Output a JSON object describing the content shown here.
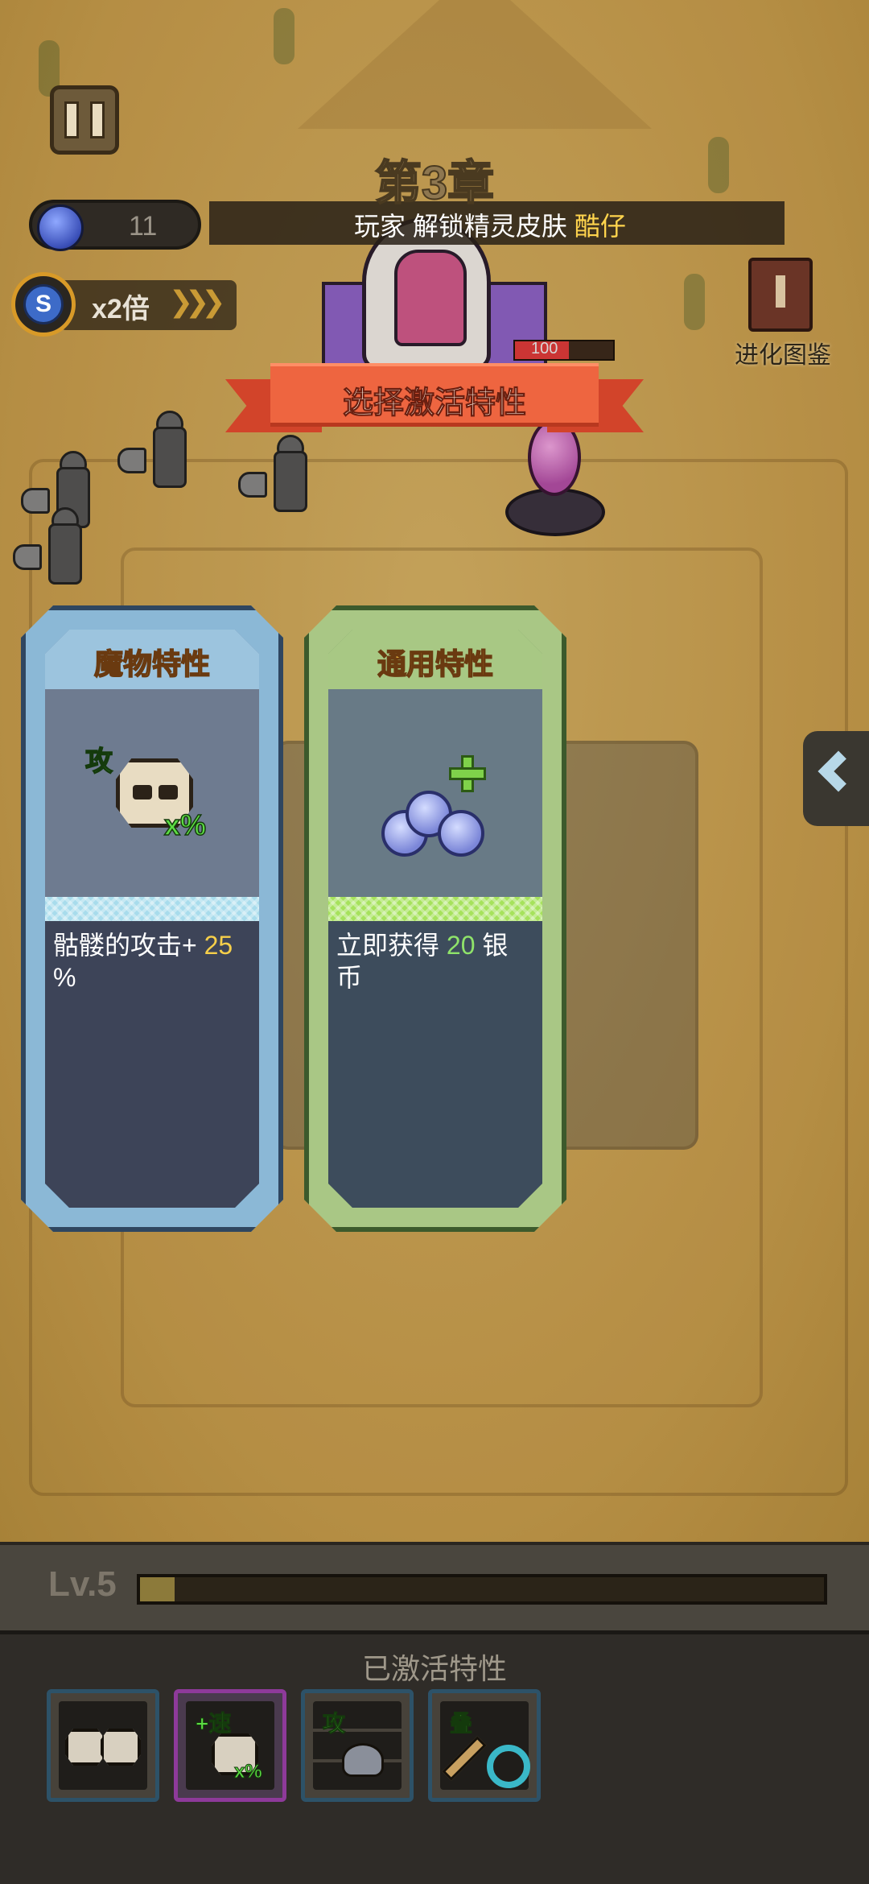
{
  "hud": {
    "chapter": "第3章",
    "gem_count": "11",
    "speed_label": "x2倍",
    "speed_badge": "S",
    "evolve_label": "进化图鉴",
    "pause_icon": "pause-icon"
  },
  "announcement": {
    "prefix": "玩家",
    "message": "解锁精灵皮肤",
    "player": "酷仔"
  },
  "boss": {
    "hp_text": "100",
    "hp_fraction": 0.55
  },
  "dialog": {
    "title": "选择激活特性",
    "cards": [
      {
        "title": "魔物特性",
        "icon": "skull-attack-percent-icon",
        "icon_tag": "攻",
        "icon_suffix": "x%",
        "desc_prefix": "骷髅的攻击+ ",
        "desc_value": "25",
        "desc_suffix": "%"
      },
      {
        "title": "通用特性",
        "icon": "silver-coins-plus-icon",
        "desc_prefix": "立即获得 ",
        "desc_value": "20",
        "desc_suffix": " 银币"
      }
    ]
  },
  "level": {
    "label": "Lv.5",
    "progress": 0.05
  },
  "activated": {
    "title": "已激活特性",
    "traits": [
      {
        "icon": "double-skull-icon",
        "tag": ""
      },
      {
        "icon": "skull-speed-icon",
        "tag": "+速",
        "suffix": "x%"
      },
      {
        "icon": "slime-grid-attack-icon",
        "tag": "攻"
      },
      {
        "icon": "sword-swirl-stack-icon",
        "tag": "叠"
      }
    ]
  },
  "colors": {
    "ribbon": "#ee6540",
    "monster_card": "#8bb8d6",
    "general_card": "#a9c785",
    "highlight_yellow": "#ffd44d",
    "highlight_green": "#8fe36a"
  }
}
